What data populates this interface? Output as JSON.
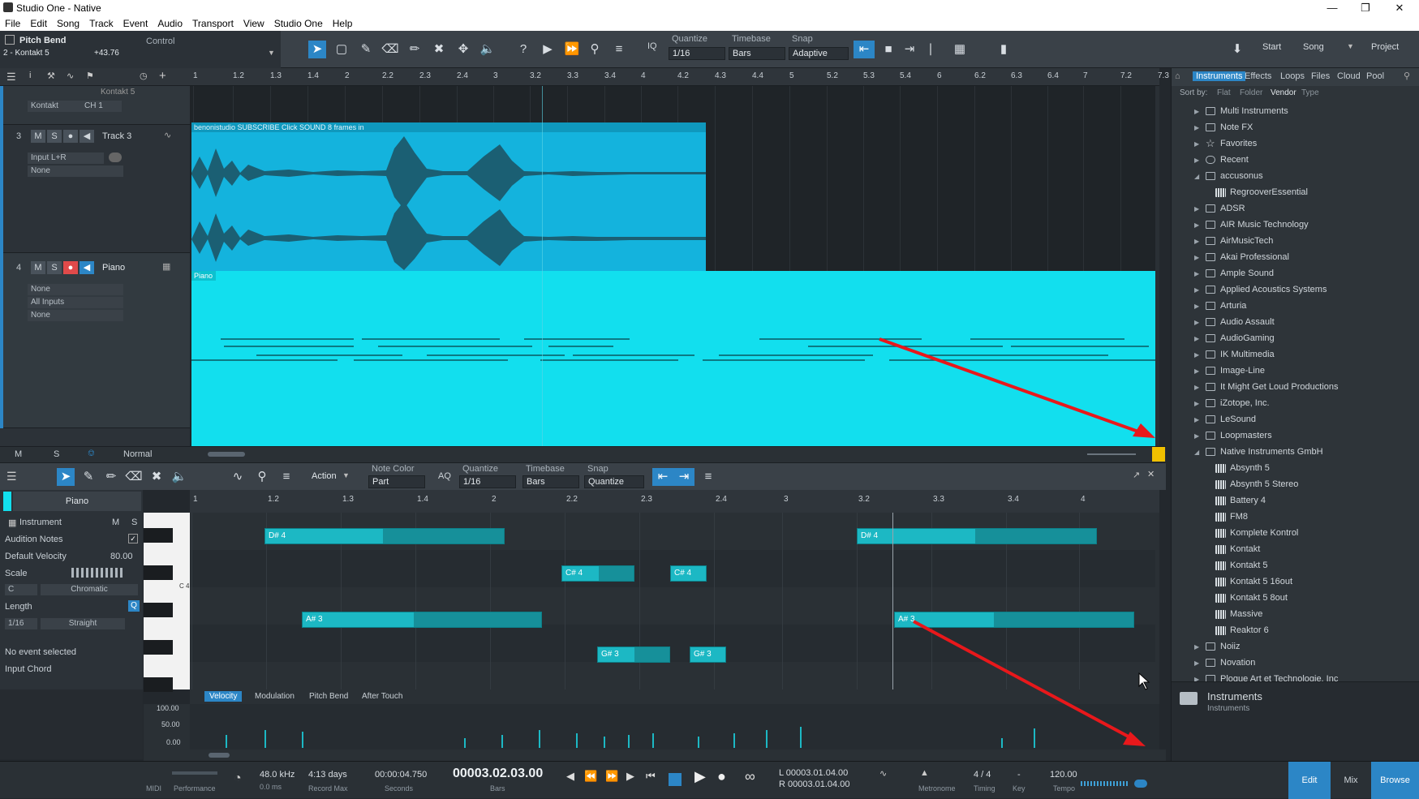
{
  "window": {
    "title": "Studio One - Native"
  },
  "menu": [
    "File",
    "Edit",
    "Song",
    "Track",
    "Event",
    "Audio",
    "Transport",
    "View",
    "Studio One",
    "Help"
  ],
  "toolbar": {
    "control_name": "Pitch Bend",
    "control_label": "Control",
    "device": "2 - Kontakt 5",
    "device_value": "+43.76",
    "quantize_label": "Quantize",
    "quantize_value": "1/16",
    "timebase_label": "Timebase",
    "timebase_value": "Bars",
    "snap_label": "Snap",
    "snap_value": "Adaptive",
    "iq": "IQ",
    "start": "Start",
    "song": "Song",
    "project": "Project"
  },
  "ruler": [
    "1",
    "1.2",
    "1.3",
    "1.4",
    "2",
    "2.2",
    "2.3",
    "2.4",
    "3",
    "3.2",
    "3.3",
    "3.4",
    "4",
    "4.2",
    "4.3",
    "4.4",
    "5",
    "5.2",
    "5.3",
    "5.4",
    "6",
    "6.2",
    "6.3",
    "6.4",
    "7",
    "7.2",
    "7.3"
  ],
  "tracks": [
    {
      "num": "",
      "name": "Kontakt 5",
      "io1": "Kontakt",
      "io2": "CH 1"
    },
    {
      "num": "3",
      "name": "Track 3",
      "io1": "Input L+R",
      "io2": "None"
    },
    {
      "num": "4",
      "name": "Piano",
      "io1": "None",
      "io2": "All Inputs",
      "io3": "None"
    }
  ],
  "clips": {
    "audio_title": "benonistudio SUBSCRIBE Click SOUND 8 frames in",
    "piano_title": "Piano"
  },
  "arrange_footer": {
    "m": "M",
    "s": "S",
    "mode": "Normal"
  },
  "browser": {
    "tabs": [
      "Instruments",
      "Effects",
      "Loops",
      "Files",
      "Cloud",
      "Pool"
    ],
    "sort_label": "Sort by:",
    "sort_options": [
      "Flat",
      "Folder",
      "Vendor",
      "Type"
    ],
    "items": [
      {
        "label": "Multi Instruments",
        "type": "folder",
        "level": 0
      },
      {
        "label": "Note FX",
        "type": "folder",
        "level": 0
      },
      {
        "label": "Favorites",
        "type": "star",
        "level": 0
      },
      {
        "label": "Recent",
        "type": "clock",
        "level": 0
      },
      {
        "label": "accusonus",
        "type": "folder-open",
        "level": 0
      },
      {
        "label": "RegrooverEssential",
        "type": "plugin",
        "level": 1
      },
      {
        "label": "ADSR",
        "type": "folder",
        "level": 0
      },
      {
        "label": "AIR Music Technology",
        "type": "folder",
        "level": 0
      },
      {
        "label": "AirMusicTech",
        "type": "folder",
        "level": 0
      },
      {
        "label": "Akai Professional",
        "type": "folder",
        "level": 0
      },
      {
        "label": "Ample Sound",
        "type": "folder",
        "level": 0
      },
      {
        "label": "Applied Acoustics Systems",
        "type": "folder",
        "level": 0
      },
      {
        "label": "Arturia",
        "type": "folder",
        "level": 0
      },
      {
        "label": "Audio Assault",
        "type": "folder",
        "level": 0
      },
      {
        "label": "AudioGaming",
        "type": "folder",
        "level": 0
      },
      {
        "label": "IK Multimedia",
        "type": "folder",
        "level": 0
      },
      {
        "label": "Image-Line",
        "type": "folder",
        "level": 0
      },
      {
        "label": "It Might Get Loud Productions",
        "type": "folder",
        "level": 0
      },
      {
        "label": "iZotope, Inc.",
        "type": "folder",
        "level": 0
      },
      {
        "label": "LeSound",
        "type": "folder",
        "level": 0
      },
      {
        "label": "Loopmasters",
        "type": "folder",
        "level": 0
      },
      {
        "label": "Native Instruments GmbH",
        "type": "folder-open",
        "level": 0
      },
      {
        "label": "Absynth 5",
        "type": "plugin",
        "level": 1
      },
      {
        "label": "Absynth 5 Stereo",
        "type": "plugin",
        "level": 1
      },
      {
        "label": "Battery 4",
        "type": "plugin",
        "level": 1
      },
      {
        "label": "FM8",
        "type": "plugin",
        "level": 1
      },
      {
        "label": "Komplete Kontrol",
        "type": "plugin",
        "level": 1
      },
      {
        "label": "Kontakt",
        "type": "plugin",
        "level": 1
      },
      {
        "label": "Kontakt 5",
        "type": "plugin",
        "level": 1
      },
      {
        "label": "Kontakt 5 16out",
        "type": "plugin",
        "level": 1
      },
      {
        "label": "Kontakt 5 8out",
        "type": "plugin",
        "level": 1
      },
      {
        "label": "Massive",
        "type": "plugin",
        "level": 1
      },
      {
        "label": "Reaktor 6",
        "type": "plugin",
        "level": 1
      },
      {
        "label": "Noiiz",
        "type": "folder",
        "level": 0
      },
      {
        "label": "Novation",
        "type": "folder",
        "level": 0
      },
      {
        "label": "Plogue Art et Technologie, Inc",
        "type": "folder",
        "level": 0
      }
    ],
    "footer_title": "Instruments",
    "footer_sub": "Instruments"
  },
  "editor": {
    "action": "Action",
    "note_color_label": "Note Color",
    "note_color_value": "Part",
    "aq": "AQ",
    "quantize_label": "Quantize",
    "quantize_value": "1/16",
    "timebase_label": "Timebase",
    "timebase_value": "Bars",
    "snap_label": "Snap",
    "snap_value": "Quantize",
    "part_name": "Piano",
    "instrument": "Instrument",
    "m": "M",
    "s": "S",
    "audition": "Audition Notes",
    "default_velocity_label": "Default Velocity",
    "default_velocity_value": "80.00",
    "scale_label": "Scale",
    "scale_root": "C",
    "scale_type": "Chromatic",
    "length_label": "Length",
    "length_value": "1/16",
    "length_mode": "Straight",
    "no_event": "No event selected",
    "input_chord": "Input Chord",
    "key_label": "C 4",
    "ruler": [
      "1",
      "1.2",
      "1.3",
      "1.4",
      "2",
      "2.2",
      "2.3",
      "2.4",
      "3",
      "3.2",
      "3.3",
      "3.4",
      "4"
    ],
    "notes": [
      {
        "label": "D# 4",
        "row": 0
      },
      {
        "label": "D# 4",
        "row": 0
      },
      {
        "label": "C# 4",
        "row": 1
      },
      {
        "label": "C# 4",
        "row": 1
      },
      {
        "label": "A# 3",
        "row": 3
      },
      {
        "label": "A# 3",
        "row": 3
      },
      {
        "label": "G# 3",
        "row": 4
      },
      {
        "label": "G# 3",
        "row": 4
      }
    ],
    "vel_tabs": [
      "Velocity",
      "Modulation",
      "Pitch Bend",
      "After Touch"
    ],
    "vel_scale": [
      "100.00",
      "50.00",
      "0.00"
    ]
  },
  "transport": {
    "midi": "MIDI",
    "performance": "Performance",
    "rate": "48.0 kHz",
    "rate_sub": "0.0 ms",
    "record": "4:13 days",
    "record_sub": "Record Max",
    "seconds": "00:00:04.750",
    "seconds_sub": "Seconds",
    "bars": "00003.02.03.00",
    "bars_sub": "Bars",
    "loop_l": "L  00003.01.04.00",
    "loop_r": "R  00003.01.04.00",
    "metronome": "Metronome",
    "timesig": "4 / 4",
    "timing": "Timing",
    "key": "-",
    "key_sub": "Key",
    "tempo": "120.00",
    "tempo_sub": "Tempo",
    "edit": "Edit",
    "mix": "Mix",
    "browse": "Browse"
  },
  "colors": {
    "accent": "#2c86c6",
    "audio_clip": "#14b3dd",
    "midi_clip": "#12dfee",
    "note": "#1cb8c4",
    "arrow": "#e8181b"
  }
}
